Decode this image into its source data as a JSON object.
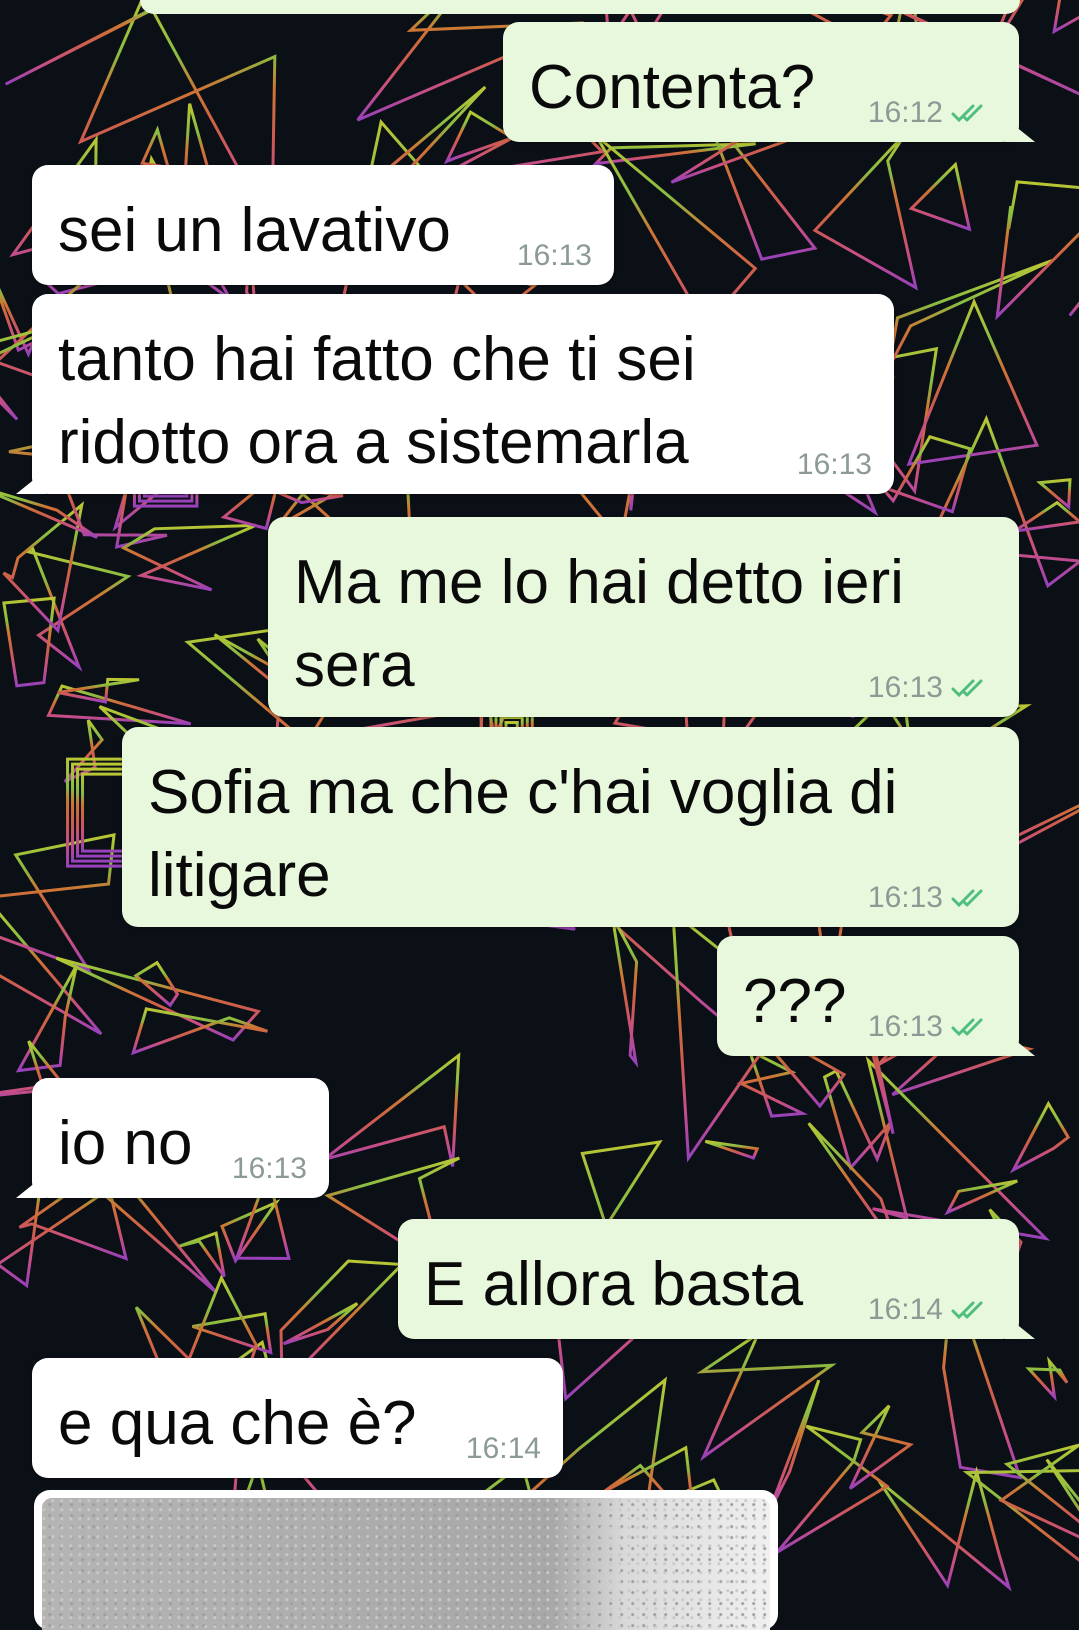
{
  "wallpaper": {
    "accent_top": "#d9e63a",
    "accent_mid": "#f06a3a",
    "accent_bottom": "#b04ad8"
  },
  "colors": {
    "incoming": "#ffffff",
    "outgoing": "#e7f8dd",
    "time": "#8c9a96",
    "tick_read": "#4fbf7c"
  },
  "messages": [
    {
      "direction": "out",
      "text": "Contenta?",
      "time": "16:12",
      "ticks": "double-check-icon"
    },
    {
      "direction": "in",
      "text": "sei un lavativo",
      "time": "16:13"
    },
    {
      "direction": "in",
      "text": "tanto hai fatto che ti sei\nridotto ora a sistemarla",
      "time": "16:13"
    },
    {
      "direction": "out",
      "text": "Ma me lo hai detto ieri\nsera",
      "time": "16:13",
      "ticks": "double-check-icon"
    },
    {
      "direction": "out",
      "text": "Sofia ma che c'hai voglia di\nlitigare",
      "time": "16:13",
      "ticks": "double-check-icon"
    },
    {
      "direction": "out",
      "text": "???",
      "time": "16:13",
      "ticks": "double-check-icon"
    },
    {
      "direction": "in",
      "text": "io no",
      "time": "16:13"
    },
    {
      "direction": "out",
      "text": "E allora basta",
      "time": "16:14",
      "ticks": "double-check-icon"
    },
    {
      "direction": "in",
      "text": "e qua che è?",
      "time": "16:14"
    }
  ],
  "image_message": {
    "direction": "in",
    "icon": "photo-thumbnail"
  }
}
